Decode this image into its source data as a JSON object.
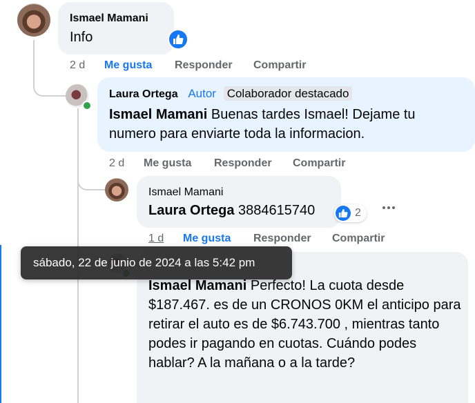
{
  "comments": [
    {
      "author": "Ismael Mamani",
      "text": "Info",
      "time": "2 d",
      "like_label": "Me gusta",
      "reply_label": "Responder",
      "share_label": "Compartir"
    },
    {
      "author": "Laura Ortega",
      "author_badge": "Autor",
      "contributor_badge": "Colaborador destacado",
      "mention": "Ismael Mamani",
      "text": " Buenas tardes Ismael! Dejame tu numero para enviarte toda la informacion.",
      "time": "2 d",
      "like_label": "Me gusta",
      "reply_label": "Responder",
      "share_label": "Compartir"
    },
    {
      "author": "Ismael Mamani",
      "mention": "Laura Ortega",
      "text": " 3884615740",
      "reaction_count": "2",
      "time": "1 d",
      "like_label": "Me gusta",
      "reply_label": "Responder",
      "share_label": "Compartir"
    },
    {
      "mention": "Ismael Mamani",
      "text": " Perfecto! La cuota desde $187.467. es de un CRONOS 0KM el anticipo para retirar el auto es de $6.743.700 , mientras tanto podes ir pagando en cuotas. Cuándo podes hablar? A la mañana o a la tarde?"
    }
  ],
  "tooltip": "sábado, 22 de junio de 2024 a las 5:42 pm",
  "icons": {
    "like": "thumbs-up-icon",
    "more": "more-options-icon"
  },
  "colors": {
    "accent": "#1877f2",
    "bubble": "#f0f2f5",
    "bubble_highlight": "#e7f3ff",
    "meta": "#65676b",
    "online": "#31a24c"
  }
}
